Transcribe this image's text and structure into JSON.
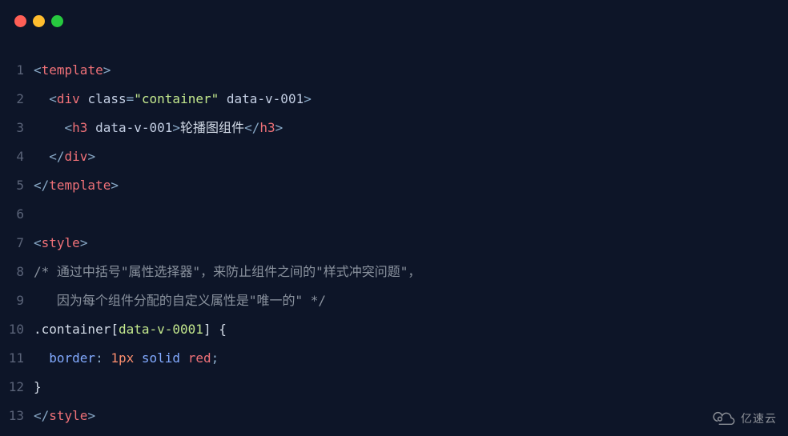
{
  "titlebar": {
    "buttons": [
      "close",
      "minimize",
      "zoom"
    ]
  },
  "code": {
    "lines": [
      {
        "num": "1",
        "tokens": [
          {
            "cls": "tag-bracket",
            "t": "<"
          },
          {
            "cls": "tag-name",
            "t": "template"
          },
          {
            "cls": "tag-bracket",
            "t": ">"
          }
        ]
      },
      {
        "num": "2",
        "tokens": [
          {
            "cls": "plain",
            "t": "  "
          },
          {
            "cls": "tag-bracket",
            "t": "<"
          },
          {
            "cls": "tag-name",
            "t": "div"
          },
          {
            "cls": "plain",
            "t": " "
          },
          {
            "cls": "attr-name",
            "t": "class"
          },
          {
            "cls": "equals",
            "t": "="
          },
          {
            "cls": "attr-value",
            "t": "\"container\""
          },
          {
            "cls": "plain",
            "t": " "
          },
          {
            "cls": "attr-name",
            "t": "data-v-001"
          },
          {
            "cls": "tag-bracket",
            "t": ">"
          }
        ]
      },
      {
        "num": "3",
        "tokens": [
          {
            "cls": "plain",
            "t": "    "
          },
          {
            "cls": "tag-bracket",
            "t": "<"
          },
          {
            "cls": "tag-name",
            "t": "h3"
          },
          {
            "cls": "plain",
            "t": " "
          },
          {
            "cls": "attr-name",
            "t": "data-v-001"
          },
          {
            "cls": "tag-bracket",
            "t": ">"
          },
          {
            "cls": "plain",
            "t": "轮播图组件"
          },
          {
            "cls": "tag-bracket",
            "t": "</"
          },
          {
            "cls": "tag-name",
            "t": "h3"
          },
          {
            "cls": "tag-bracket",
            "t": ">"
          }
        ]
      },
      {
        "num": "4",
        "tokens": [
          {
            "cls": "plain",
            "t": "  "
          },
          {
            "cls": "tag-bracket",
            "t": "</"
          },
          {
            "cls": "tag-name",
            "t": "div"
          },
          {
            "cls": "tag-bracket",
            "t": ">"
          }
        ]
      },
      {
        "num": "5",
        "tokens": [
          {
            "cls": "tag-bracket",
            "t": "</"
          },
          {
            "cls": "tag-name",
            "t": "template"
          },
          {
            "cls": "tag-bracket",
            "t": ">"
          }
        ]
      },
      {
        "num": "6",
        "tokens": []
      },
      {
        "num": "7",
        "tokens": [
          {
            "cls": "tag-bracket",
            "t": "<"
          },
          {
            "cls": "tag-name",
            "t": "style"
          },
          {
            "cls": "tag-bracket",
            "t": ">"
          }
        ]
      },
      {
        "num": "8",
        "tokens": [
          {
            "cls": "comment",
            "t": "/* 通过中括号\"属性选择器\"，来防止组件之间的\"样式冲突问题\"，"
          }
        ]
      },
      {
        "num": "9",
        "tokens": [
          {
            "cls": "comment",
            "t": "   因为每个组件分配的自定义属性是\"唯一的\" */"
          }
        ]
      },
      {
        "num": "10",
        "tokens": [
          {
            "cls": "selector-class",
            "t": ".container"
          },
          {
            "cls": "plain",
            "t": "["
          },
          {
            "cls": "selector-attr",
            "t": "data-v-0001"
          },
          {
            "cls": "plain",
            "t": "]"
          },
          {
            "cls": "plain",
            "t": " "
          },
          {
            "cls": "brace",
            "t": "{"
          }
        ]
      },
      {
        "num": "11",
        "tokens": [
          {
            "cls": "plain",
            "t": "  "
          },
          {
            "cls": "prop",
            "t": "border"
          },
          {
            "cls": "colon",
            "t": ": "
          },
          {
            "cls": "val-px",
            "t": "1px"
          },
          {
            "cls": "plain",
            "t": " "
          },
          {
            "cls": "val-id",
            "t": "solid"
          },
          {
            "cls": "plain",
            "t": " "
          },
          {
            "cls": "val-color",
            "t": "red"
          },
          {
            "cls": "semi",
            "t": ";"
          }
        ]
      },
      {
        "num": "12",
        "tokens": [
          {
            "cls": "brace",
            "t": "}"
          }
        ]
      },
      {
        "num": "13",
        "tokens": [
          {
            "cls": "tag-bracket",
            "t": "</"
          },
          {
            "cls": "tag-name",
            "t": "style"
          },
          {
            "cls": "tag-bracket",
            "t": ">"
          }
        ]
      }
    ]
  },
  "watermark": {
    "text": "亿速云"
  }
}
